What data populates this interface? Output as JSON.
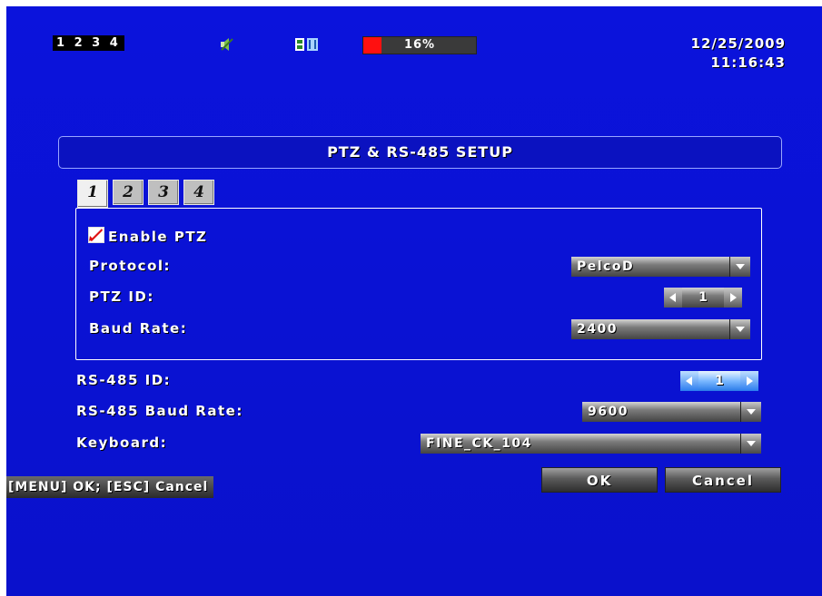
{
  "status_bar": {
    "cameras": "1 2 3 4",
    "hdd_usage_label": "16%",
    "hdd_usage_fraction": 0.16,
    "date": "12/25/2009",
    "time": "11:16:43",
    "icons": [
      "audio-mute-icon",
      "record-status-icon"
    ]
  },
  "dialog": {
    "title": "PTZ & RS-485 SETUP",
    "tabs": [
      "1",
      "2",
      "3",
      "4"
    ],
    "active_tab": "1",
    "enable_ptz_label": "Enable PTZ",
    "enable_ptz_checked": true,
    "protocol_label": "Protocol:",
    "protocol_value": "PelcoD",
    "ptz_id_label": "PTZ ID:",
    "ptz_id_value": "1",
    "baud_rate_label": "Baud Rate:",
    "baud_rate_value": "2400",
    "rs485_id_label": "RS-485 ID:",
    "rs485_id_value": "1",
    "rs485_baud_label": "RS-485 Baud Rate:",
    "rs485_baud_value": "9600",
    "keyboard_label": "Keyboard:",
    "keyboard_value": "FINE_CK_104",
    "hint": "[MENU] OK; [ESC] Cancel",
    "ok_label": "OK",
    "cancel_label": "Cancel"
  },
  "colors": {
    "background": "#0a12d2",
    "hdd_fill": "#ff1010",
    "check_mark": "#e01010",
    "spinner_active": "#2a7be8"
  }
}
